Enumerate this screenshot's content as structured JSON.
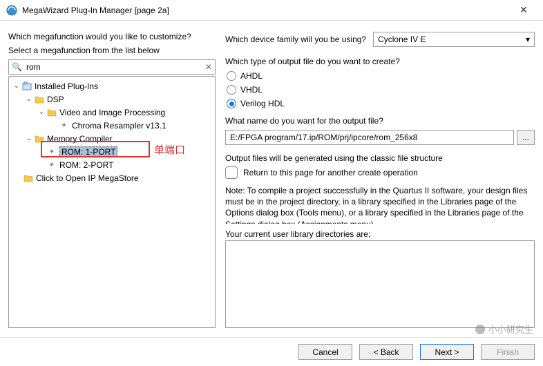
{
  "window": {
    "title": "MegaWizard Plug-In Manager [page 2a]",
    "close_glyph": "✕"
  },
  "left": {
    "prompt_customize": "Which megafunction would you like to customize?",
    "prompt_select": "Select a megafunction from the list below",
    "search_value": "rom",
    "tree": {
      "root": "Installed Plug-Ins",
      "dsp": "DSP",
      "vip": "Video and Image Processing",
      "chroma": "Chroma Resampler v13.1",
      "memcomp": "Memory Compiler",
      "rom1": "ROM: 1-PORT",
      "rom2": "ROM: 2-PORT",
      "megastore": "Click to Open IP MegaStore"
    },
    "annotation_text": "单端口"
  },
  "right": {
    "device_q": "Which device family will you be using?",
    "device_value": "Cyclone IV E",
    "output_type_q": "Which type of output file do you want to create?",
    "radio_ahdl": "AHDL",
    "radio_vhdl": "VHDL",
    "radio_verilog": "Verilog HDL",
    "output_name_q": "What name do you want for the output file?",
    "output_path": "E:/FPGA program/17.ip/ROM/prj/ipcore/rom_256x8",
    "browse_label": "...",
    "classic_note": "Output files will be generated using the classic file structure",
    "return_check": "Return to this page for another create operation",
    "compile_note": "Note: To compile a project successfully in the Quartus II software, your design files must be in the project directory, in a library specified in the Libraries page of the Options dialog box (Tools menu), or a library specified in the Libraries page of the Settings dialog box (Assignments menu).",
    "lib_label": "Your current user library directories are:"
  },
  "footer": {
    "cancel": "Cancel",
    "back": "< Back",
    "next": "Next >",
    "finish": "Finish"
  },
  "watermark": "小小研究生"
}
